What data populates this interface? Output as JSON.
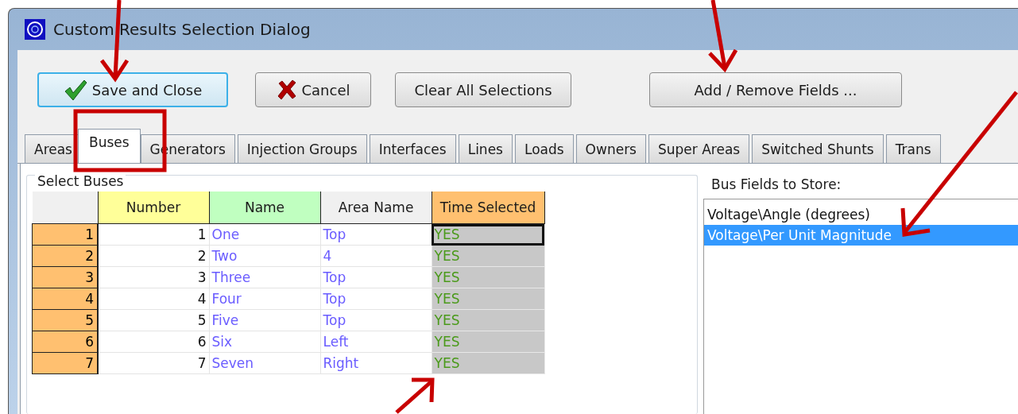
{
  "window": {
    "title": "Custom Results Selection Dialog"
  },
  "buttons": [
    {
      "label": "Save and Close",
      "kind": "save",
      "focused": true
    },
    {
      "label": "Cancel",
      "kind": "cancel",
      "focused": false
    },
    {
      "label": "Clear All Selections",
      "kind": "plain",
      "focused": false
    },
    {
      "label": "Add / Remove Fields ...",
      "kind": "plain",
      "focused": false
    }
  ],
  "tabs": [
    {
      "label": "Areas",
      "selected": false
    },
    {
      "label": "Buses",
      "selected": true
    },
    {
      "label": "Generators",
      "selected": false
    },
    {
      "label": "Injection Groups",
      "selected": false
    },
    {
      "label": "Interfaces",
      "selected": false
    },
    {
      "label": "Lines",
      "selected": false
    },
    {
      "label": "Loads",
      "selected": false
    },
    {
      "label": "Owners",
      "selected": false
    },
    {
      "label": "Super Areas",
      "selected": false
    },
    {
      "label": "Switched Shunts",
      "selected": false
    },
    {
      "label": "Trans",
      "selected": false
    }
  ],
  "group": {
    "title": "Select Buses"
  },
  "table": {
    "columns": [
      {
        "label": "Number",
        "color": "#ffff99"
      },
      {
        "label": "Name",
        "color": "#c0ffc0"
      },
      {
        "label": "Area Name",
        "color": "#f0f0f0"
      },
      {
        "label": "Time Selected",
        "color": "#ffc070"
      }
    ],
    "rows": [
      {
        "header": "1",
        "cells": [
          "1",
          "One",
          "Top",
          "YES"
        ],
        "focused": true
      },
      {
        "header": "2",
        "cells": [
          "2",
          "Two",
          "4",
          "YES"
        ],
        "focused": false
      },
      {
        "header": "3",
        "cells": [
          "3",
          "Three",
          "Top",
          "YES"
        ],
        "focused": false
      },
      {
        "header": "4",
        "cells": [
          "4",
          "Four",
          "Top",
          "YES"
        ],
        "focused": false
      },
      {
        "header": "5",
        "cells": [
          "5",
          "Five",
          "Top",
          "YES"
        ],
        "focused": false
      },
      {
        "header": "6",
        "cells": [
          "6",
          "Six",
          "Left",
          "YES"
        ],
        "focused": false
      },
      {
        "header": "7",
        "cells": [
          "7",
          "Seven",
          "Right",
          "YES"
        ],
        "focused": false
      }
    ]
  },
  "fields_panel": {
    "label": "Bus Fields to Store:",
    "items": [
      {
        "label": "Voltage\\Angle (degrees)",
        "selected": false
      },
      {
        "label": "Voltage\\Per Unit Magnitude",
        "selected": true
      }
    ]
  }
}
